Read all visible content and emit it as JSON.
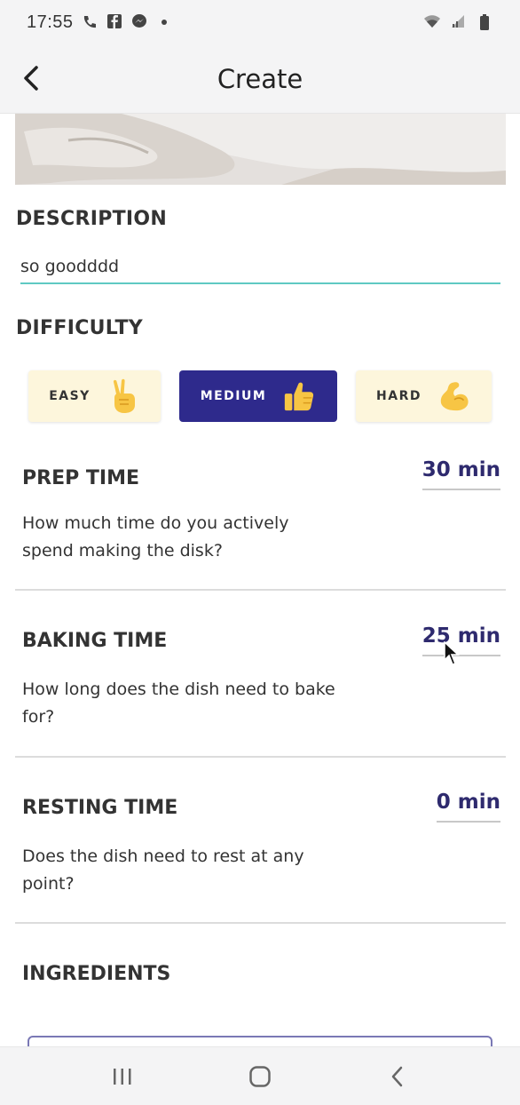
{
  "status_bar": {
    "time": "17:55",
    "icons_left": [
      "call-icon",
      "facebook-icon",
      "messenger-icon",
      "dot-icon"
    ],
    "icons_right": [
      "wifi-icon",
      "signal-icon",
      "battery-icon"
    ]
  },
  "app_bar": {
    "title": "Create",
    "back_icon": "back-arrow-icon"
  },
  "description": {
    "label": "DESCRIPTION",
    "value": "so goodddd"
  },
  "difficulty": {
    "label": "DIFFICULTY",
    "options": [
      {
        "label": "EASY",
        "icon": "victory-hand-icon",
        "selected": false
      },
      {
        "label": "MEDIUM",
        "icon": "thumbs-up-icon",
        "selected": true
      },
      {
        "label": "HARD",
        "icon": "flexed-biceps-icon",
        "selected": false
      }
    ]
  },
  "times": [
    {
      "title": "PREP TIME",
      "description": "How much time do you actively spend making the disk?",
      "value": "30 min"
    },
    {
      "title": "BAKING TIME",
      "description": "How long does the dish need to bake for?",
      "value": "25 min"
    },
    {
      "title": "RESTING TIME",
      "description": "Does the dish need to rest at any point?",
      "value": "0 min"
    }
  ],
  "ingredients": {
    "label": "INGREDIENTS"
  },
  "colors": {
    "accent": "#2e2a8c",
    "input_underline": "#5fc9c3",
    "value_text": "#2e2a6e",
    "difficulty_off_bg": "#fdf6dc"
  },
  "nav_bar": {
    "icons": [
      "recent-apps-icon",
      "home-icon",
      "back-icon"
    ]
  }
}
